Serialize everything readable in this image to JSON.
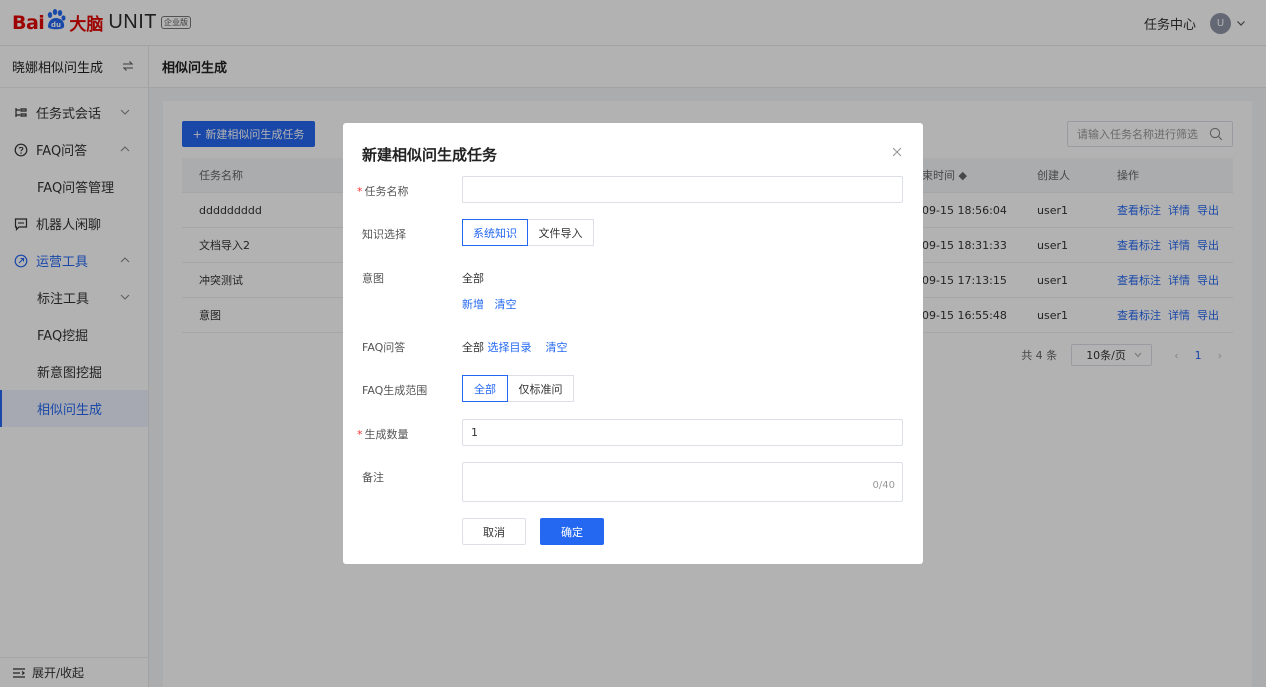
{
  "header": {
    "logo": {
      "bai": "Bai",
      "paw_text": "du",
      "danao": "大脑",
      "unit": "UNIT",
      "badge": "企业版"
    },
    "task_center": "任务中心",
    "avatar_initial": "U"
  },
  "sidebar": {
    "bot_name": "晓娜相似问生成",
    "items": [
      {
        "label": "任务式会话",
        "icon": "flow-icon"
      },
      {
        "label": "FAQ问答",
        "icon": "question-circle-icon"
      },
      {
        "label": "FAQ问答管理"
      },
      {
        "label": "机器人闲聊",
        "icon": "chat-icon"
      },
      {
        "label": "运营工具",
        "icon": "tools-icon"
      },
      {
        "label": "标注工具"
      },
      {
        "label": "FAQ挖掘"
      },
      {
        "label": "新意图挖掘"
      },
      {
        "label": "相似问生成"
      }
    ],
    "footer": "展开/收起"
  },
  "page": {
    "title": "相似问生成",
    "new_task_button": "+ 新建相似问生成任务",
    "search_placeholder": "请输入任务名称进行筛选",
    "table": {
      "headers": [
        "任务名称",
        "束时间 ◆",
        "创建人",
        "操作"
      ],
      "rows": [
        {
          "name": "ddddddddd",
          "time": "09-15 18:56:04",
          "creator": "user1"
        },
        {
          "name": "文档导入2",
          "time": "09-15 18:31:33",
          "creator": "user1"
        },
        {
          "name": "冲突测试",
          "time": "09-15 17:13:15",
          "creator": "user1"
        },
        {
          "name": "意图",
          "time": "09-15 16:55:48",
          "creator": "user1"
        }
      ],
      "actions": {
        "view_label": "查看标注",
        "detail": "详情",
        "export": "导出"
      }
    },
    "pagination": {
      "total": "共 4 条",
      "page_size": "10条/页",
      "current_page": "1"
    }
  },
  "modal": {
    "title": "新建相似问生成任务",
    "task_name_label": "任务名称",
    "task_name_value": "",
    "knowledge_label": "知识选择",
    "knowledge_options": [
      "系统知识",
      "文件导入"
    ],
    "intent_label": "意图",
    "intent_value": "全部",
    "intent_add": "新增",
    "intent_clear": "清空",
    "faq_label": "FAQ问答",
    "faq_value": "全部",
    "faq_select": "选择目录",
    "faq_clear": "清空",
    "range_label": "FAQ生成范围",
    "range_options": [
      "全部",
      "仅标准问"
    ],
    "count_label": "生成数量",
    "count_value": "1",
    "note_label": "备注",
    "note_counter": "0/40",
    "cancel": "取消",
    "confirm": "确定"
  }
}
